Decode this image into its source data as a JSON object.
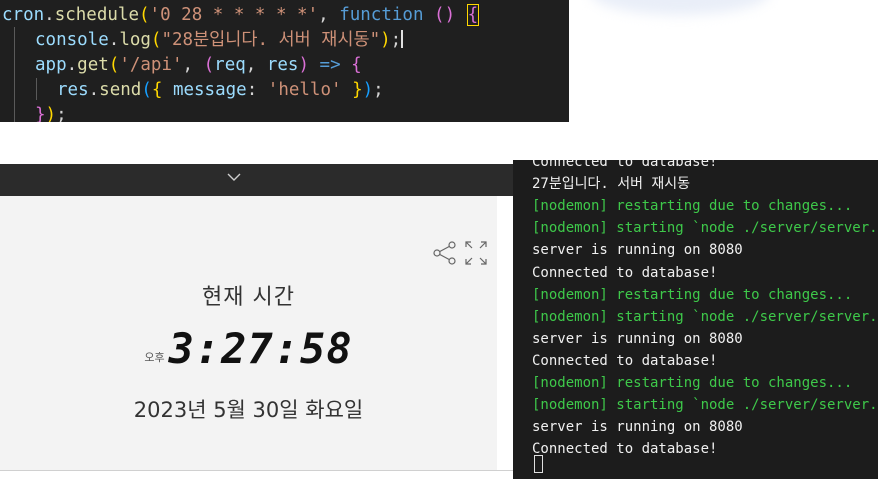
{
  "code": {
    "line1": {
      "obj": "cron",
      "dot": ".",
      "method": "schedule",
      "open": "(",
      "str": "'0 28 * * * * *'",
      "comma": ", ",
      "kw": "function",
      "sp": " ",
      "parens": "()",
      "sp2": " ",
      "brace": "{"
    },
    "line2": {
      "obj": "console",
      "dot": ".",
      "method": "log",
      "open": "(",
      "str": "\"28분입니다. 서버 재시동\"",
      "close": ")",
      "semi": ";"
    },
    "line3": {
      "obj": "app",
      "dot": ".",
      "method": "get",
      "open": "(",
      "str": "'/api'",
      "comma": ", ",
      "p_open": "(",
      "arg1": "req",
      "sep": ", ",
      "arg2": "res",
      "p_close": ")",
      "arrow": " => ",
      "brace": "{"
    },
    "line4": {
      "obj": "res",
      "dot": ".",
      "method": "send",
      "open": "(",
      "obj_open": "{ ",
      "key": "message",
      "colon": ": ",
      "str": "'hello'",
      "obj_close": " }",
      "close": ")",
      "semi": ";"
    },
    "line5": {
      "brace": "}",
      "close": ")",
      "semi": ";"
    }
  },
  "clock_widget": {
    "label": "현재 시간",
    "ampm": "오후",
    "time": "3:27:58",
    "date": "2023년 5월 30일 화요일"
  },
  "terminal": {
    "lines": [
      {
        "text": "Connected to database!",
        "color": "white"
      },
      {
        "text": "27분입니다. 서버 재시동",
        "color": "white"
      },
      {
        "text": "[nodemon] restarting due to changes...",
        "color": "green"
      },
      {
        "text": "[nodemon] starting `node ./server/server.js",
        "color": "green"
      },
      {
        "text": "server is running on 8080",
        "color": "white"
      },
      {
        "text": "Connected to database!",
        "color": "white"
      },
      {
        "text": "[nodemon] restarting due to changes...",
        "color": "green"
      },
      {
        "text": "[nodemon] starting `node ./server/server.js",
        "color": "green"
      },
      {
        "text": "server is running on 8080",
        "color": "white"
      },
      {
        "text": "Connected to database!",
        "color": "white"
      },
      {
        "text": "[nodemon] restarting due to changes...",
        "color": "green"
      },
      {
        "text": "[nodemon] starting `node ./server/server.js",
        "color": "green"
      },
      {
        "text": "server is running on 8080",
        "color": "white"
      },
      {
        "text": "Connected to database!",
        "color": "white"
      }
    ]
  },
  "icons": {
    "share": "share-icon",
    "expand": "expand-icon",
    "chevron": "chevron-down-icon"
  },
  "colors": {
    "editor_bg": "#1f1f1f",
    "terminal_bg": "#1c1c1c",
    "terminal_green": "#3ec94a",
    "widget_bg": "#f3f3f3"
  }
}
